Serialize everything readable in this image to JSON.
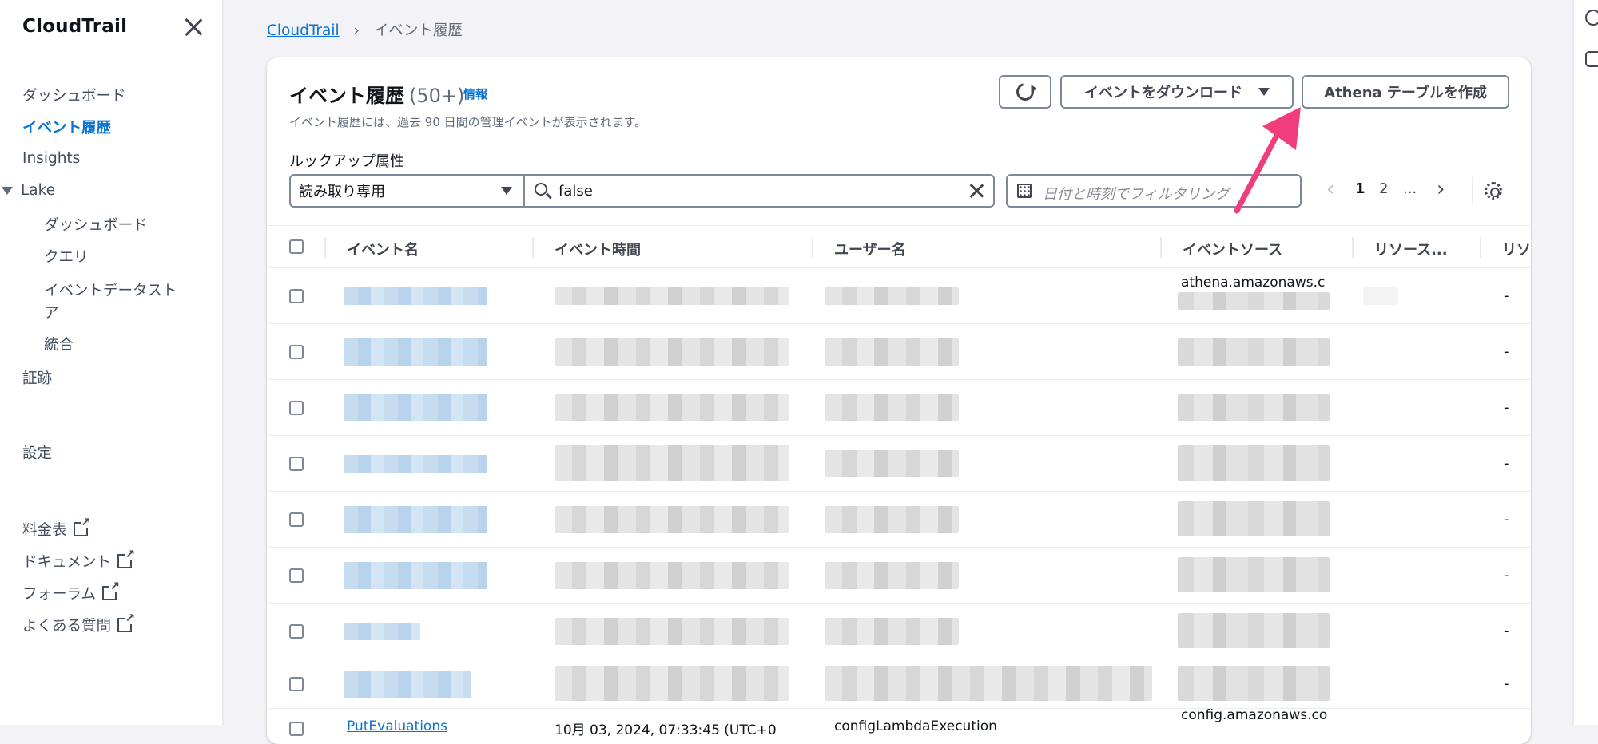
{
  "sidebar": {
    "title": "CloudTrail",
    "items": [
      {
        "label": "ダッシュボード"
      },
      {
        "label": "イベント履歴"
      },
      {
        "label": "Insights"
      },
      {
        "label": "Lake"
      },
      {
        "label": "ダッシュボード"
      },
      {
        "label": "クエリ"
      },
      {
        "label": "イベントデータスト"
      },
      {
        "label": "ア"
      },
      {
        "label": "統合"
      },
      {
        "label": "証跡"
      },
      {
        "label": "設定"
      }
    ],
    "links": [
      {
        "label": "料金表"
      },
      {
        "label": "ドキュメント"
      },
      {
        "label": "フォーラム"
      },
      {
        "label": "よくある質問"
      }
    ]
  },
  "breadcrumb": {
    "root": "CloudTrail",
    "sep": "›",
    "current": "イベント履歴"
  },
  "header": {
    "title": "イベント履歴",
    "count": "(50+)",
    "info": "情報",
    "description": "イベント履歴には、過去 90 日間の管理イベントが表示されます。",
    "download_label": "イベントをダウンロード",
    "athena_label": "Athena テーブルを作成"
  },
  "filters": {
    "lookup_label": "ルックアップ属性",
    "attribute": "読み取り専用",
    "search_value": "false",
    "date_placeholder": "日付と時刻でフィルタリング"
  },
  "pagination": {
    "pages": [
      "1",
      "2",
      "..."
    ],
    "current": "1"
  },
  "table": {
    "columns": [
      "イベント名",
      "イベント時間",
      "ユーザー名",
      "イベントソース",
      "リソース...",
      "リソ"
    ],
    "rows": [
      {
        "source": "athena.amazonaws.c",
        "resource": "-"
      },
      {
        "source": "",
        "resource": "-"
      },
      {
        "source": "",
        "resource": "-"
      },
      {
        "source": "",
        "resource": "-"
      },
      {
        "source": "",
        "resource": "-"
      },
      {
        "source": "",
        "resource": "-"
      },
      {
        "source": "",
        "resource": "-"
      },
      {
        "source": "",
        "resource": "-"
      },
      {
        "event": "PutEvaluations",
        "time": "10月 03, 2024, 07:33:45 (UTC+0",
        "user": "configLambdaExecution",
        "source": "config.amazonaws.co"
      }
    ]
  },
  "colors": {
    "accent": "#0972d3",
    "arrow": "#f03e7c"
  }
}
